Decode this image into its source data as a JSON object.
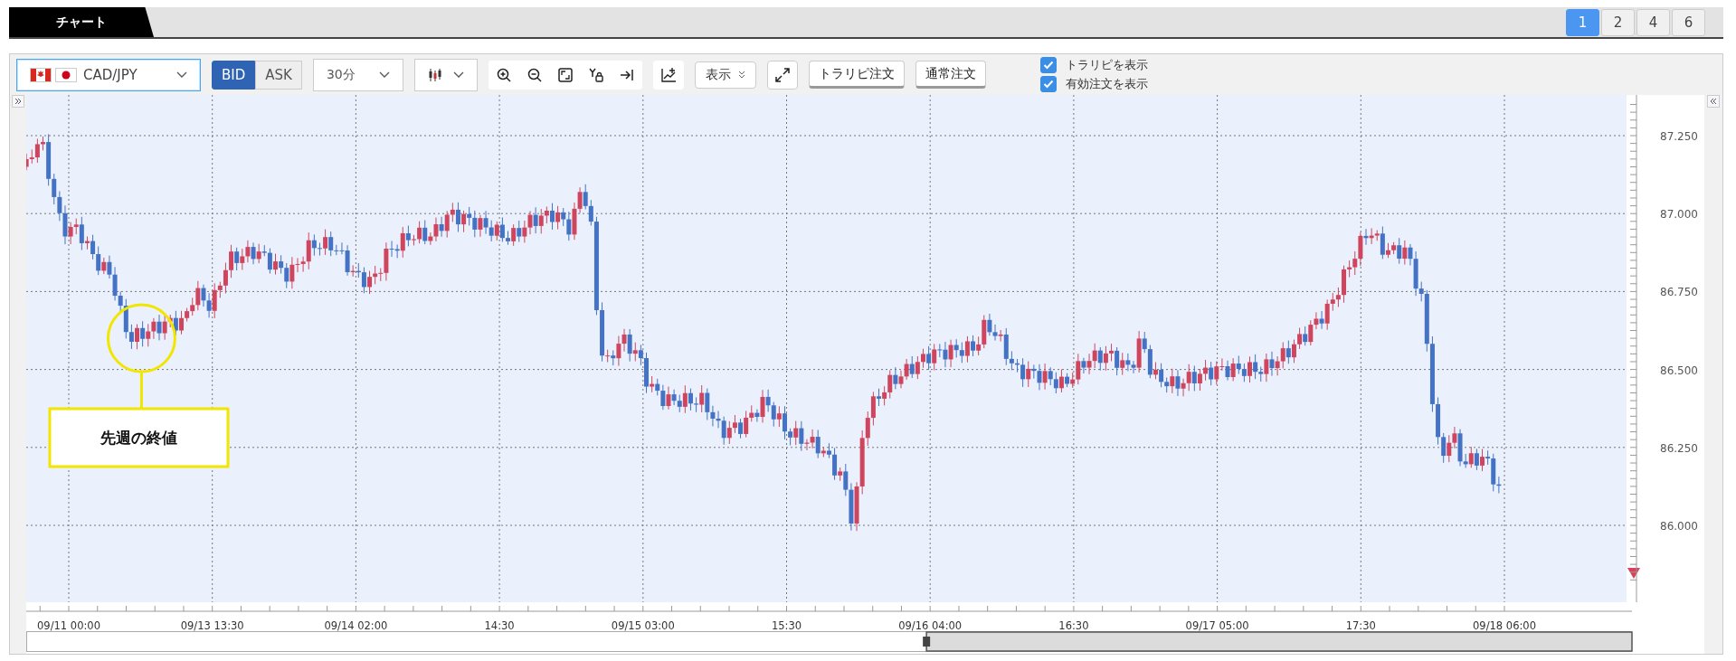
{
  "tab_bar": {
    "tabs": [
      {
        "label": "チャート",
        "selected": true
      }
    ],
    "layout_buttons": [
      {
        "label": "1",
        "selected": true
      },
      {
        "label": "2",
        "selected": false
      },
      {
        "label": "4",
        "selected": false
      },
      {
        "label": "6",
        "selected": false
      }
    ]
  },
  "toolbar": {
    "symbol": "CAD/JPY",
    "price_sides": [
      {
        "label": "BID",
        "selected": true
      },
      {
        "label": "ASK",
        "selected": false
      }
    ],
    "timeframe": "30分",
    "display_button": "表示",
    "order_buttons": [
      "トラリピ注文",
      "通常注文"
    ],
    "checkboxes": [
      {
        "label": "トラリピを表示",
        "checked": true
      },
      {
        "label": "有効注文を表示",
        "checked": true
      }
    ]
  },
  "chart": {
    "y_axis": [
      "87.250",
      "87.000",
      "86.750",
      "86.500",
      "86.250",
      "86.000"
    ],
    "x_axis": [
      "09/11 00:00",
      "09/13 13:30",
      "09/14 02:00",
      "14:30",
      "09/15 03:00",
      "15:30",
      "09/16 04:00",
      "16:30",
      "09/17 05:00",
      "17:30",
      "09/18 06:00"
    ],
    "callout": "先週の終値"
  }
}
